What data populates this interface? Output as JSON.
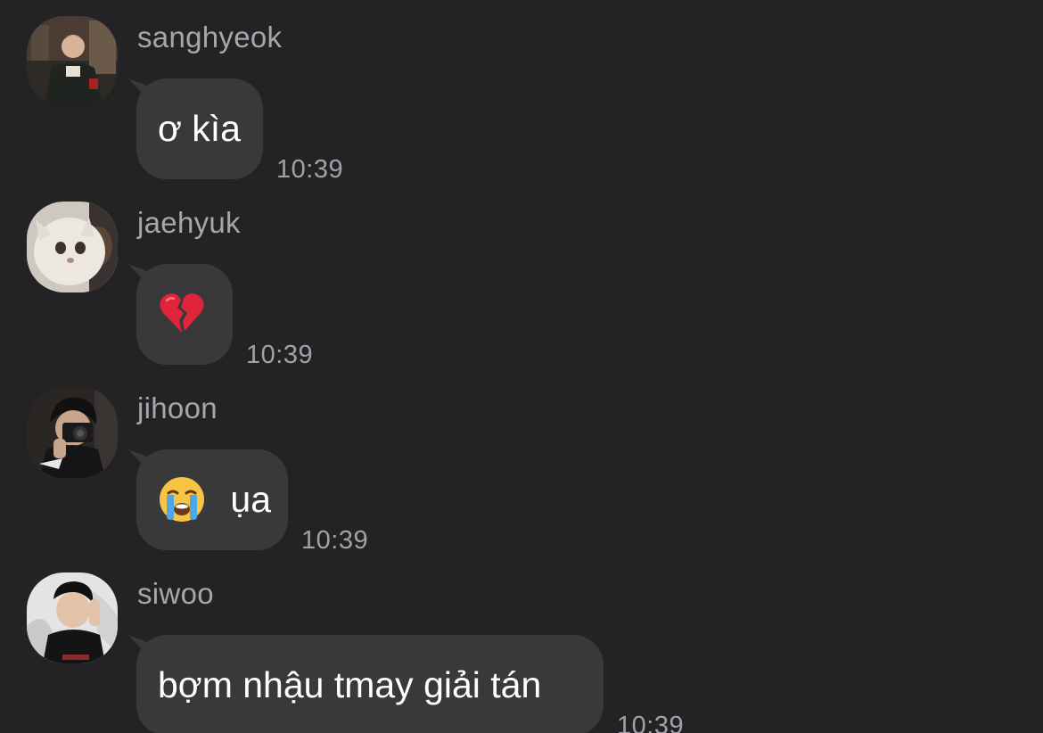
{
  "messages": [
    {
      "sender": "sanghyeok",
      "avatar": "sanghyeok-avatar",
      "text": "ơ kìa",
      "emoji": "",
      "time": "10:39"
    },
    {
      "sender": "jaehyuk",
      "avatar": "jaehyuk-avatar",
      "text": "",
      "emoji": "broken-heart",
      "time": "10:39"
    },
    {
      "sender": "jihoon",
      "avatar": "jihoon-avatar",
      "text": "ụa",
      "emoji": "loudly-crying-face",
      "time": "10:39"
    },
    {
      "sender": "siwoo",
      "avatar": "siwoo-avatar",
      "text": "bợm nhậu tmay giải tán",
      "emoji": "",
      "time": "10:39"
    }
  ],
  "colors": {
    "background": "#232325",
    "bubble": "#39393c",
    "text": "#ffffff",
    "meta_text": "#a7a7ab"
  }
}
